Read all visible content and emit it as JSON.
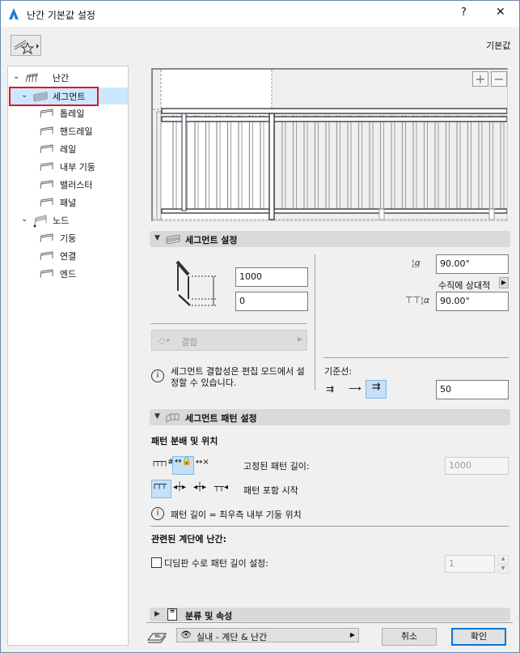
{
  "window": {
    "title": "난간 기본값 설정",
    "help": "?",
    "close": "✕"
  },
  "toolbar": {
    "defaults_label": "기본값"
  },
  "tree": {
    "root": "난간",
    "segment": "세그먼트",
    "segment_children": [
      "톱레일",
      "핸드레일",
      "레일",
      "내부 기둥",
      "밸러스터",
      "패널"
    ],
    "node": "노드",
    "node_children": [
      "기둥",
      "연결",
      "엔드"
    ]
  },
  "preview": {
    "zoom_in": "+",
    "zoom_out": "−"
  },
  "segment_settings": {
    "title": "세그먼트 설정",
    "height": "1000",
    "offset": "0",
    "angle1": "90.00°",
    "relative_label": "수직에 상대적",
    "angle2": "90.00°",
    "join_button": "결합",
    "info": "세그먼트 결합성은 편집 모드에서 설정할 수 있습니다.",
    "baseline_label": "기준선:",
    "baseline_value": "50"
  },
  "pattern_settings": {
    "title": "세그먼트 패턴 설정",
    "distribution_heading": "패턴 분배 및 위치",
    "fixed_length_label": "고정된 패턴 길이:",
    "fixed_length_value": "1000",
    "pattern_start_label": "패턴 포함 시작",
    "info": "패턴 길이 = 최우측 내부 기둥 위치",
    "stair_heading": "관련된 계단에 난간:",
    "tread_checkbox_label": "디딤판 수로 패턴 길이 설정:",
    "tread_checked": false,
    "tread_value": "1"
  },
  "classification": {
    "title": "분류 및 속성"
  },
  "footer": {
    "layer": "실내 - 계단 & 난간",
    "cancel": "취소",
    "ok": "확인"
  },
  "colors": {
    "selection": "#cce8ff",
    "highlight": "#e81123",
    "accent": "#0078d7"
  }
}
